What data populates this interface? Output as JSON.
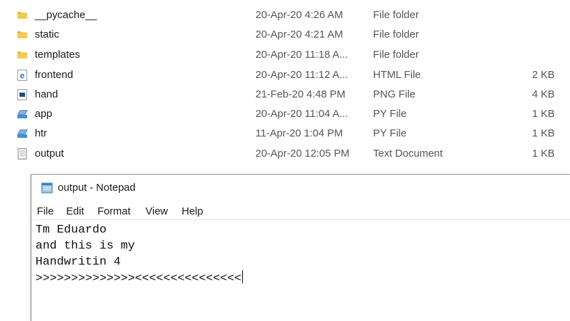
{
  "files": [
    {
      "name": "__pycache__",
      "date": "20-Apr-20 4:26 AM",
      "type": "File folder",
      "size": "",
      "icon": "folder-icon"
    },
    {
      "name": "static",
      "date": "20-Apr-20 4:21 AM",
      "type": "File folder",
      "size": "",
      "icon": "folder-icon"
    },
    {
      "name": "templates",
      "date": "20-Apr-20 11:18 A...",
      "type": "File folder",
      "size": "",
      "icon": "folder-icon"
    },
    {
      "name": "frontend",
      "date": "20-Apr-20 11:12 A...",
      "type": "HTML File",
      "size": "2 KB",
      "icon": "edge-html-icon"
    },
    {
      "name": "hand",
      "date": "21-Feb-20 4:48 PM",
      "type": "PNG File",
      "size": "4 KB",
      "icon": "image-file-icon"
    },
    {
      "name": "app",
      "date": "20-Apr-20 11:04 A...",
      "type": "PY File",
      "size": "1 KB",
      "icon": "python-file-icon"
    },
    {
      "name": "htr",
      "date": "11-Apr-20 1:04 PM",
      "type": "PY File",
      "size": "1 KB",
      "icon": "python-file-icon"
    },
    {
      "name": "output",
      "date": "20-Apr-20 12:05 PM",
      "type": "Text Document",
      "size": "1 KB",
      "icon": "text-file-icon"
    }
  ],
  "notepad": {
    "title": "output - Notepad",
    "menu": [
      "File",
      "Edit",
      "Format",
      "View",
      "Help"
    ],
    "lines": [
      "Tm Eduardo",
      "and this is my",
      "Handwritin 4",
      ">>>>>>>>>>>>>><<<<<<<<<<<<<<<"
    ]
  },
  "colors": {
    "folder": "#e8b93a",
    "edge": "#1f73c7",
    "python": "#4a8fd1"
  }
}
